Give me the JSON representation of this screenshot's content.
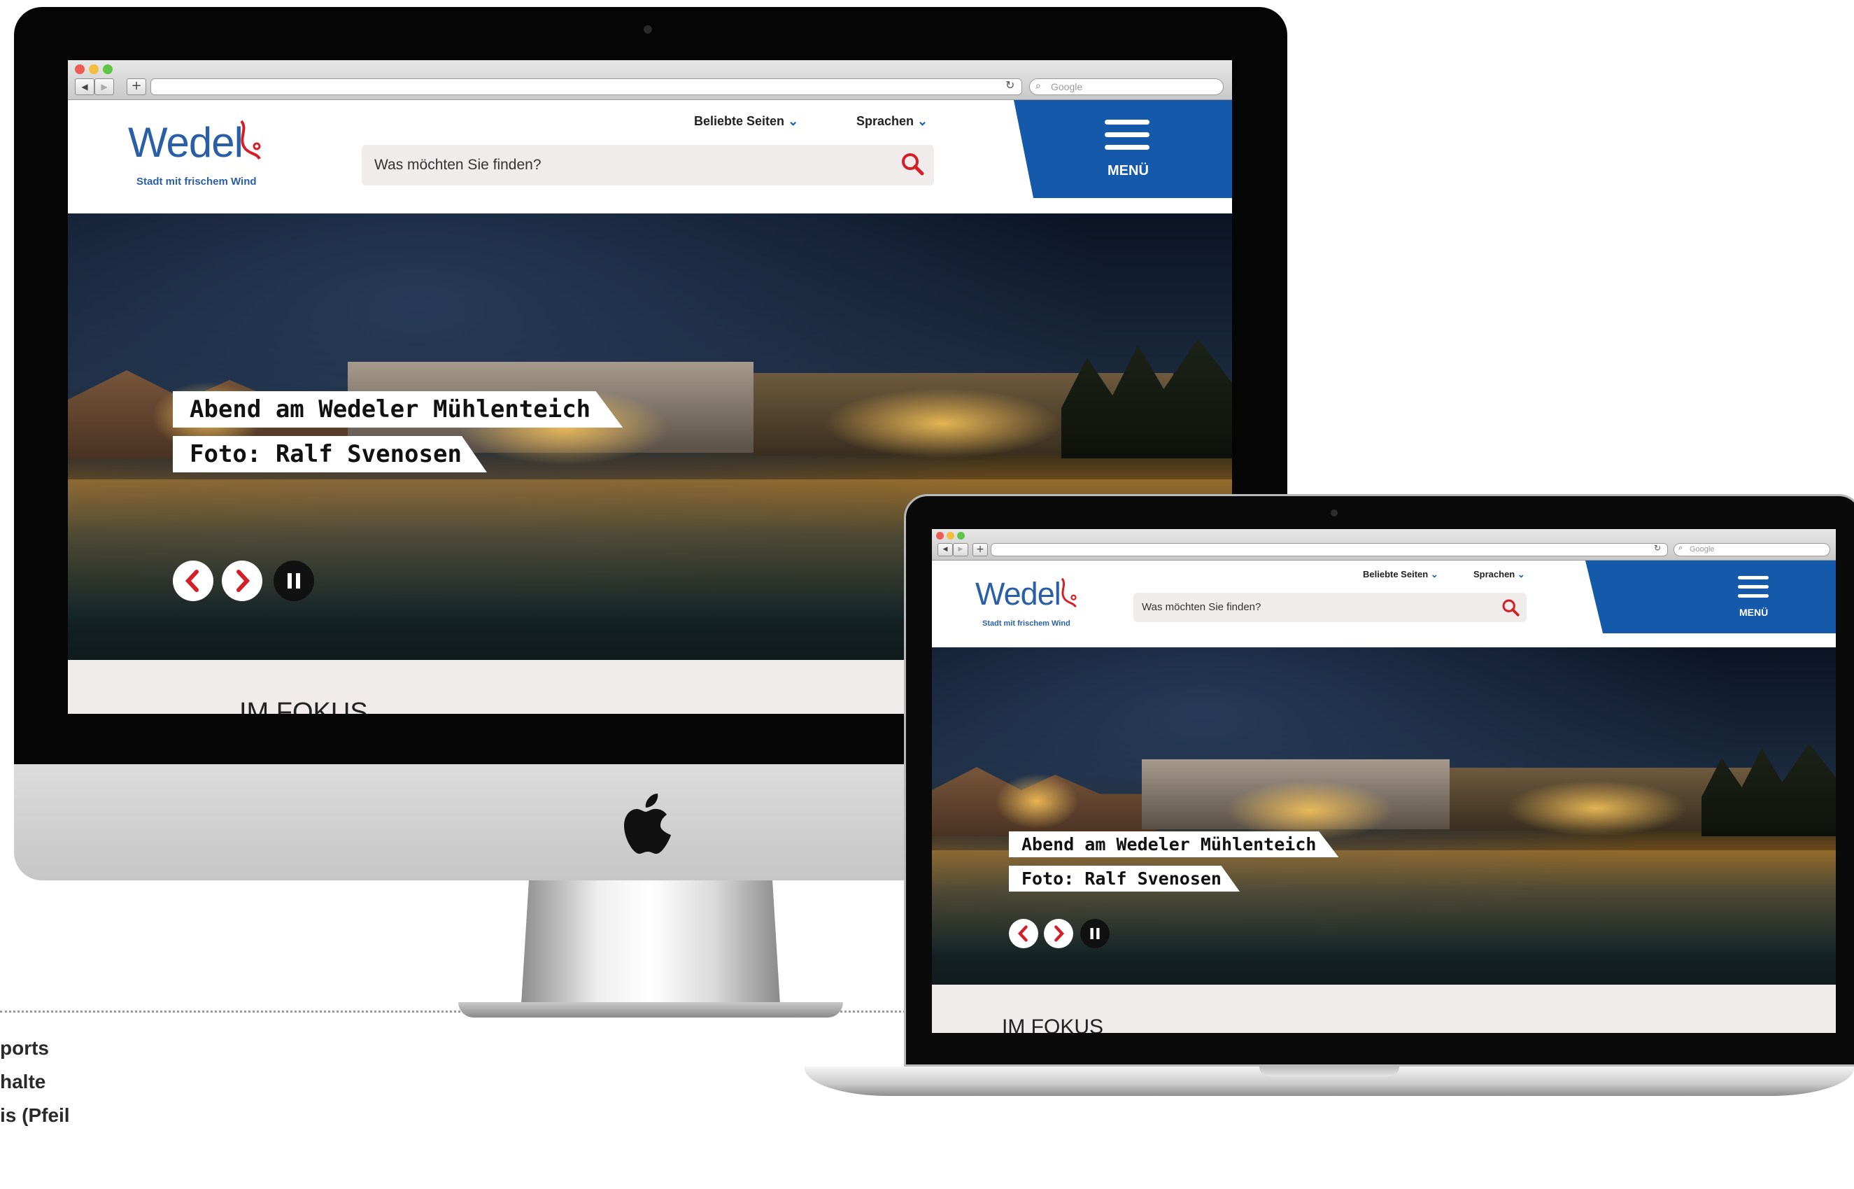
{
  "browser": {
    "search_placeholder": "Google"
  },
  "site": {
    "logo_text": "Wedel",
    "logo_tagline": "Stadt mit frischem Wind",
    "nav_popular": "Beliebte Seiten",
    "nav_languages": "Sprachen",
    "search_placeholder": "Was möchten Sie finden?",
    "menu_label": "MENÜ"
  },
  "hero": {
    "caption_title": "Abend am Wedeler Mühlenteich",
    "caption_credit": "Foto: Ralf Svenosen"
  },
  "section": {
    "focus_heading": "IM FOKUS"
  },
  "side_text": {
    "line1": "ports",
    "line2": "halte",
    "line3": "is (Pfeil"
  },
  "colors": {
    "brand_blue": "#1559ab",
    "accent_red": "#d41f26",
    "search_bg": "#efeceb"
  }
}
